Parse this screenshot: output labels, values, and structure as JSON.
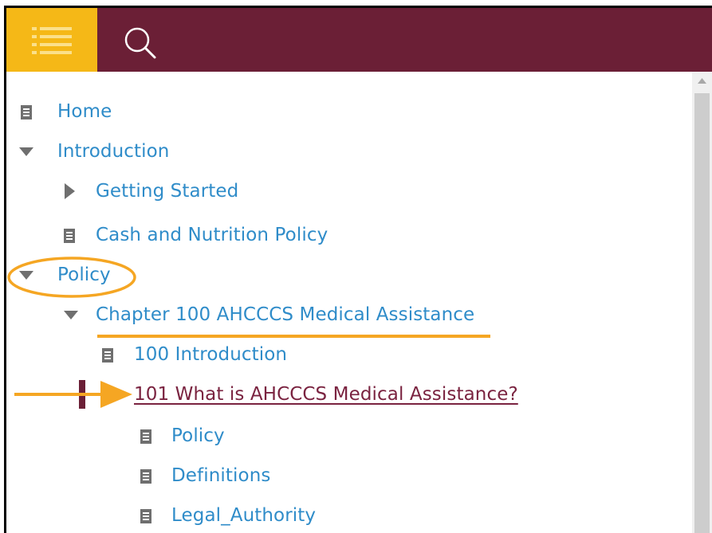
{
  "toolbar": {
    "menu_icon": "hamburger-list-icon",
    "search_icon": "magnifier-icon",
    "colors": {
      "bar": "#6b1f36",
      "menu_button": "#f5b817"
    }
  },
  "tree": {
    "home": "Home",
    "introduction": "Introduction",
    "getting_started": "Getting Started",
    "cash_nutrition": "Cash and Nutrition Policy",
    "policy": "Policy",
    "chapter_100": "Chapter 100 AHCCCS Medical Assistance",
    "intro_100": "100 Introduction",
    "what_is_101": "101 What is AHCCCS Medical Assistance?",
    "policy_sub": "Policy",
    "definitions": "Definitions",
    "legal_authority": "Legal_Authority"
  },
  "colors": {
    "link": "#2f8cc9",
    "active_link": "#7a2340",
    "annotation": "#f5a623",
    "selection_marker": "#6b1f36"
  }
}
